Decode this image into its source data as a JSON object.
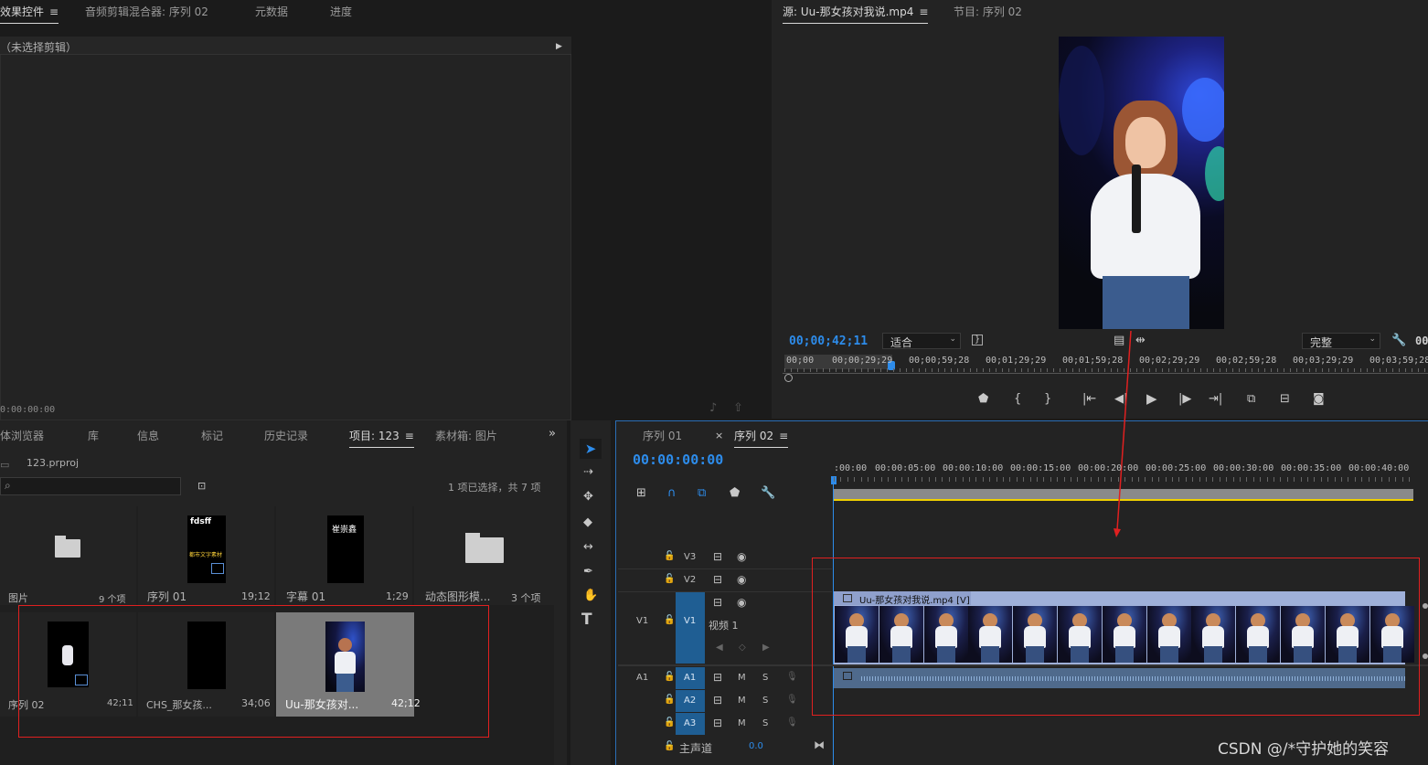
{
  "top_left_tabs": [
    "效果控件",
    "音频剪辑混合器: 序列 02",
    "元数据",
    "进度"
  ],
  "effects_panel": {
    "no_clip_text": "（未选择剪辑）",
    "timecode": "0:00:00:00"
  },
  "source_monitor": {
    "tabs": [
      "源: Uu-那女孩对我说.mp4",
      "节目: 序列 02"
    ],
    "timecode": "00;00;42;11",
    "fit_label": "适合",
    "quality_label": "完整",
    "ruler_labels": [
      "00;00",
      "00;00;29;29",
      "00;00;59;28",
      "00;01;29;29",
      "00;01;59;28",
      "00;02;29;29",
      "00;02;59;28",
      "00;03;29;29",
      "00;03;59;28"
    ],
    "right_cut": "00"
  },
  "project_panel": {
    "tabs": [
      "体浏览器",
      "库",
      "信息",
      "标记",
      "历史记录",
      "项目: 123",
      "素材箱: 图片"
    ],
    "project_file": "123.prproj",
    "selection_info": "1 项已选择，共 7 项",
    "items": [
      {
        "name": "图片",
        "meta": "9 个项",
        "kind": "folder"
      },
      {
        "name": "序列 01",
        "meta": "19;12",
        "kind": "sequence",
        "thumb_text": "fdsff",
        "thumb_sub": "都市文字素材"
      },
      {
        "name": "字幕 01",
        "meta": "1;29",
        "kind": "title",
        "thumb_text": "崔崇鑫"
      },
      {
        "name": "动态图形模...",
        "meta": "3 个项",
        "kind": "folder"
      },
      {
        "name": "序列 02",
        "meta": "42;11",
        "kind": "sequence"
      },
      {
        "name": "CHS_那女孩...",
        "meta": "34;06",
        "kind": "video"
      },
      {
        "name": "Uu-那女孩对...",
        "meta": "42;12",
        "kind": "video"
      }
    ]
  },
  "timeline": {
    "tabs": [
      "序列 01",
      "序列 02"
    ],
    "timecode": "00:00:00:00",
    "ruler_labels": [
      ":00:00",
      "00:00:05:00",
      "00:00:10:00",
      "00:00:15:00",
      "00:00:20:00",
      "00:00:25:00",
      "00:00:30:00",
      "00:00:35:00",
      "00:00:40:00"
    ],
    "tracks": {
      "v3": "V3",
      "v2": "V2",
      "v1": "V1",
      "v1_label": "视频 1",
      "a1": "A1",
      "a2": "A2",
      "a3": "A3",
      "m": "M",
      "s": "S",
      "master_label": "主声道",
      "master_value": "0.0"
    },
    "clip_label": "Uu-那女孩对我说.mp4 [V]"
  },
  "watermark": "CSDN @/*守护她的笑容",
  "colors": {
    "accent_blue": "#2d8ceb",
    "red_annotation": "#e02020",
    "timeline_yellow": "#f0d000",
    "track_blue": "#1f5e93"
  }
}
